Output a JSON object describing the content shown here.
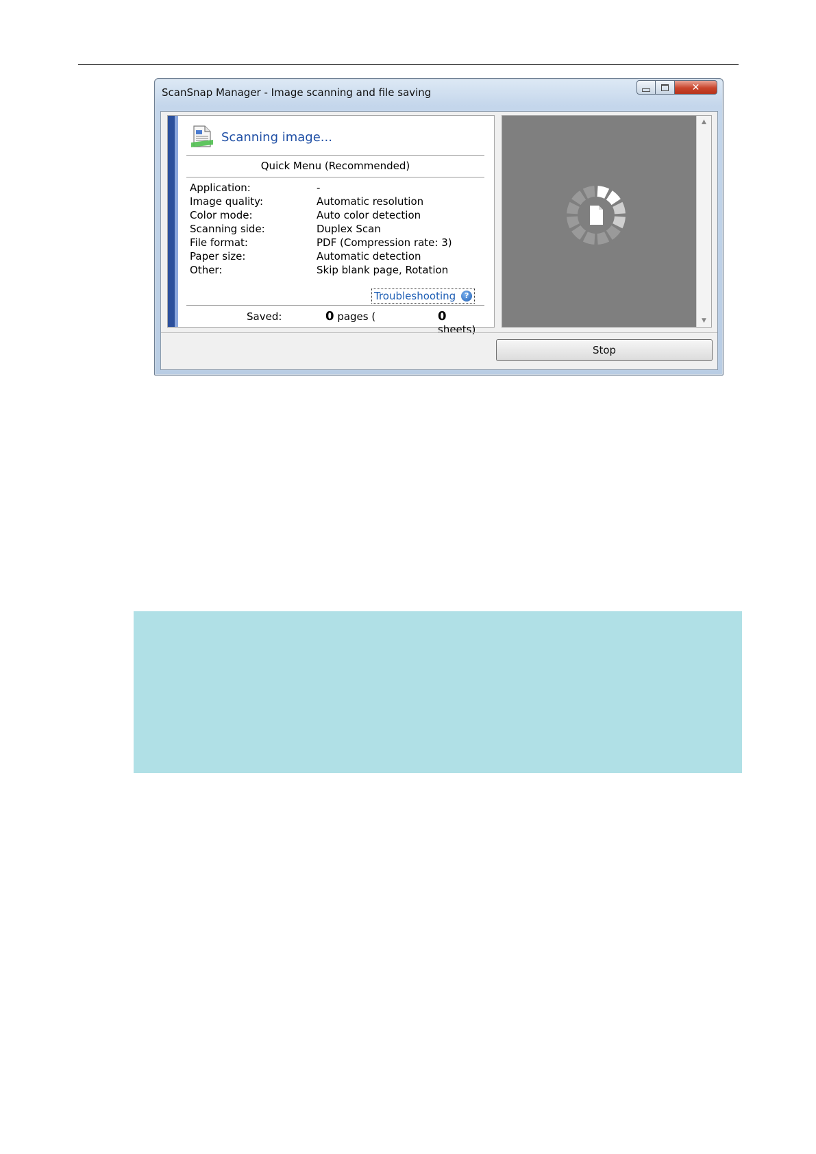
{
  "window": {
    "title": "ScanSnap Manager - Image scanning and file saving",
    "controls": {
      "minimize_icon": "minimize-icon",
      "maximize_icon": "maximize-icon",
      "close_glyph": "✕"
    }
  },
  "status": {
    "icon": "scan-document-icon",
    "text": "Scanning image..."
  },
  "profile": {
    "name": "Quick Menu (Recommended)"
  },
  "settings": [
    {
      "label": "Application:",
      "value": "-"
    },
    {
      "label": "Image quality:",
      "value": "Automatic resolution"
    },
    {
      "label": "Color mode:",
      "value": "Auto color detection"
    },
    {
      "label": "Scanning side:",
      "value": "Duplex Scan"
    },
    {
      "label": "File format:",
      "value": "PDF (Compression rate: 3)"
    },
    {
      "label": "Paper size:",
      "value": "Automatic detection"
    },
    {
      "label": "Other:",
      "value": "Skip blank page, Rotation"
    }
  ],
  "troubleshooting": {
    "label": "Troubleshooting",
    "icon": "help-icon",
    "icon_glyph": "?"
  },
  "saved": {
    "label": "Saved:",
    "pages": "0",
    "pages_text": "pages (",
    "sheets": "0",
    "sheets_text": "sheets)"
  },
  "preview": {
    "spinner_icon": "loading-spinner-icon",
    "up_arrow": "▲",
    "down_arrow": "▼"
  },
  "stop_button": {
    "label": "Stop"
  },
  "colors": {
    "accent_blue": "#1f4fa5",
    "preview_bg": "#7f7f7f",
    "note_box": "#b0e0e6"
  }
}
